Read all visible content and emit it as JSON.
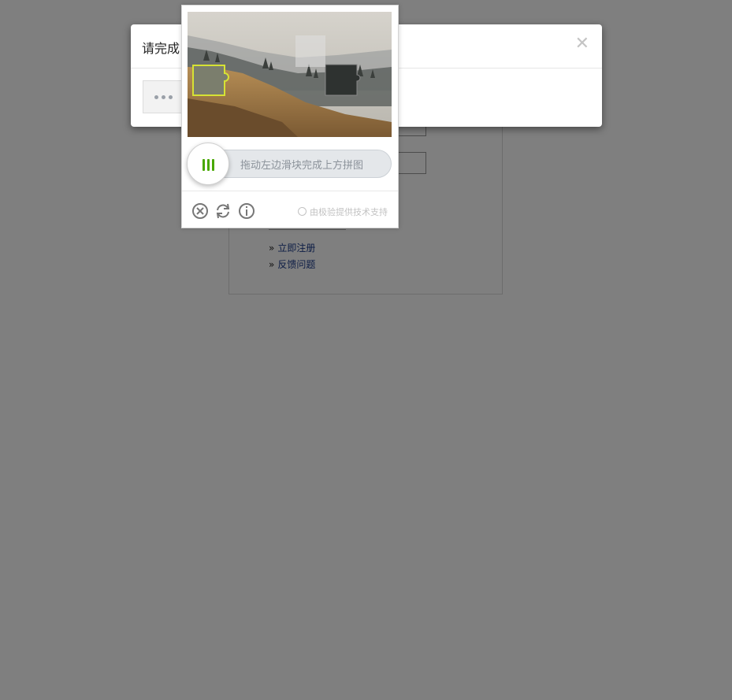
{
  "dialog": {
    "title": "请完成",
    "close_icon": "close-icon"
  },
  "captcha": {
    "slider_hint": "拖动左边滑块完成上方拼图",
    "credit": "由极验提供技术支持",
    "knob_color": "#48a800",
    "icons": [
      "close-circle-icon",
      "refresh-icon",
      "info-icon"
    ]
  },
  "login": {
    "links": [
      {
        "prefix": "»",
        "label": "立即注册"
      },
      {
        "prefix": "»",
        "label": "反馈问题"
      }
    ]
  }
}
